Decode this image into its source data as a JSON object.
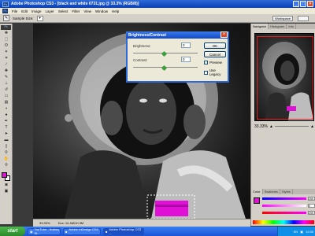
{
  "window": {
    "title": "Adobe Photoshop CS3 - [black and white 0731.jpg @ 33.3% (RGB/8)]",
    "app_badge": "Ps"
  },
  "menu": [
    "File",
    "Edit",
    "Image",
    "Layer",
    "Select",
    "Filter",
    "View",
    "Window",
    "Help"
  ],
  "options_bar": {
    "sample_label": "Sample Size:",
    "workspace_label": "Workspace"
  },
  "colors": {
    "foreground": "#e010d6",
    "background": "#ffffff",
    "accent": "#2d6ad8"
  },
  "dialog": {
    "title": "Brightness/Contrast",
    "brightness_label": "Brightness:",
    "brightness_value": "0",
    "contrast_label": "Contrast:",
    "contrast_value": "0",
    "ok_label": "OK",
    "cancel_label": "Cancel",
    "preview_label": "Preview",
    "preview_checked": true,
    "legacy_label": "Use Legacy",
    "legacy_checked": false
  },
  "document": {
    "zoom": "33.33%",
    "doc_info": "Doc: 10.4M/10.3M"
  },
  "panels": {
    "nav_tabs": [
      "Navigator",
      "Histogram",
      "Info"
    ],
    "zoom_value": "33.33%",
    "color_tabs": [
      "Color",
      "Swatches",
      "Styles"
    ],
    "color_values": {
      "R": "255",
      "G": "0",
      "B": "255"
    }
  },
  "taskbar": {
    "start_label": "start",
    "tasks": [
      {
        "label": "YouTube - lindsey St...",
        "active": false
      },
      {
        "label": "Adobe InDesign CS3 ...",
        "active": false
      },
      {
        "label": "Adobe Photoshop CS3 ...",
        "active": true
      }
    ],
    "lang": "EN",
    "clock": "10:30"
  }
}
